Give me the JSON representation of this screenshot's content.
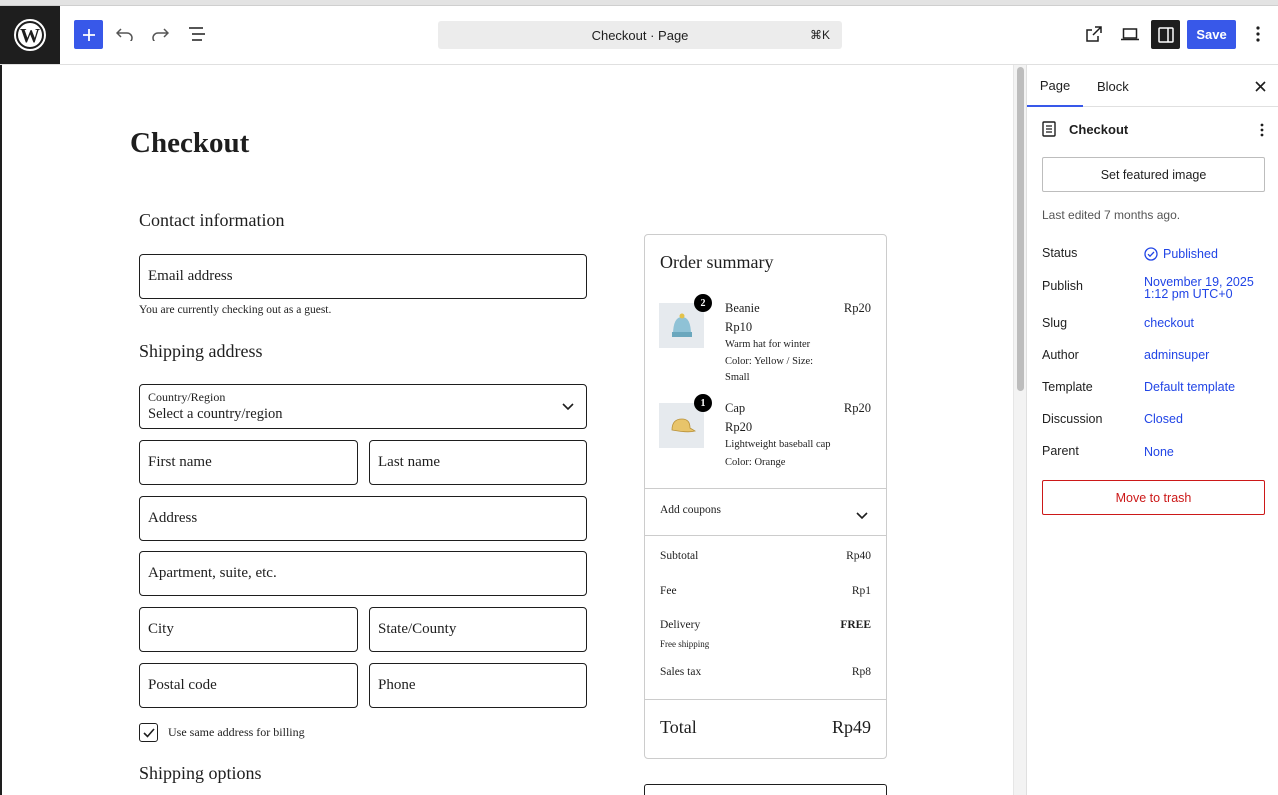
{
  "toolbar": {
    "command_title": "Checkout · Page",
    "shortcut": "⌘K",
    "save_label": "Save"
  },
  "page": {
    "title": "Checkout"
  },
  "checkout": {
    "contact_heading": "Contact information",
    "email_placeholder": "Email address",
    "guest_note": "You are currently checking out as a guest.",
    "shipping_heading": "Shipping address",
    "country_label": "Country/Region",
    "country_value": "Select a country/region",
    "first_name": "First name",
    "last_name": "Last name",
    "address": "Address",
    "apartment": "Apartment, suite, etc.",
    "city": "City",
    "state": "State/County",
    "postal_code": "Postal code",
    "phone": "Phone",
    "same_billing": "Use same address for billing",
    "shipping_options_heading": "Shipping options"
  },
  "summary": {
    "title": "Order summary",
    "items": [
      {
        "qty": "2",
        "name": "Beanie",
        "line_price": "Rp20",
        "unit_price": "Rp10",
        "desc": "Warm hat for winter",
        "variant": "Color: Yellow / Size: Small"
      },
      {
        "qty": "1",
        "name": "Cap",
        "line_price": "Rp20",
        "unit_price": "Rp20",
        "desc": "Lightweight baseball cap",
        "variant": "Color: Orange"
      }
    ],
    "coupons_label": "Add coupons",
    "subtotal_label": "Subtotal",
    "subtotal_value": "Rp40",
    "fee_label": "Fee",
    "fee_value": "Rp1",
    "delivery_label": "Delivery",
    "delivery_value": "FREE",
    "delivery_note": "Free shipping",
    "tax_label": "Sales tax",
    "tax_value": "Rp8",
    "total_label": "Total",
    "total_value": "Rp49"
  },
  "sidebar": {
    "tab_page": "Page",
    "tab_block": "Block",
    "doc_title": "Checkout",
    "featured_image": "Set featured image",
    "last_edited": "Last edited 7 months ago.",
    "meta": {
      "status_label": "Status",
      "status_value": "Published",
      "publish_label": "Publish",
      "publish_value_line1": "November 19, 2025",
      "publish_value_line2": "1:12 pm UTC+0",
      "slug_label": "Slug",
      "slug_value": "checkout",
      "author_label": "Author",
      "author_value": "adminsuper",
      "template_label": "Template",
      "template_value": "Default template",
      "discussion_label": "Discussion",
      "discussion_value": "Closed",
      "parent_label": "Parent",
      "parent_value": "None"
    },
    "trash_label": "Move to trash"
  },
  "colors": {
    "accent": "#3858e9",
    "link": "#2145e6",
    "danger": "#cc1818"
  }
}
